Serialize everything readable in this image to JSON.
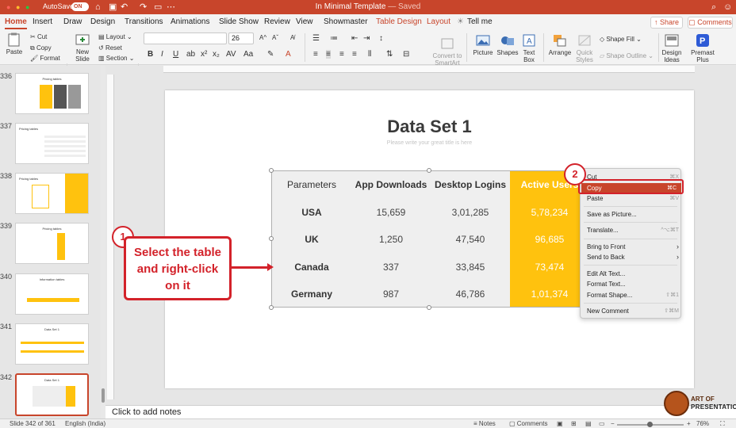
{
  "titlebar": {
    "autosave_label": "AutoSave",
    "autosave_state": "ON",
    "doc_name": "In Minimal Template",
    "doc_status": "— Saved",
    "accent_color": "#c8452b"
  },
  "tabs": [
    {
      "label": "Home",
      "active": true
    },
    {
      "label": "Insert"
    },
    {
      "label": "Draw"
    },
    {
      "label": "Design"
    },
    {
      "label": "Transitions"
    },
    {
      "label": "Animations"
    },
    {
      "label": "Slide Show"
    },
    {
      "label": "Review"
    },
    {
      "label": "View"
    },
    {
      "label": "Showmaster"
    },
    {
      "label": "Table Design",
      "contextual": true
    },
    {
      "label": "Layout",
      "contextual": true
    },
    {
      "label": "Tell me"
    }
  ],
  "share_label": "Share",
  "comments_label": "Comments",
  "ribbon": {
    "paste": "Paste",
    "cut": "Cut",
    "copy": "Copy",
    "format": "Format",
    "new_slide": "New Slide",
    "layout": "Layout",
    "reset": "Reset",
    "section": "Section",
    "font_size": "26",
    "convert_smartart": "Convert to SmartArt",
    "picture": "Picture",
    "shapes": "Shapes",
    "text_box": "Text Box",
    "arrange": "Arrange",
    "quick_styles": "Quick Styles",
    "shape_fill": "Shape Fill",
    "shape_outline": "Shape Outline",
    "design_ideas": "Design Ideas",
    "premast_plus": "Premast Plus"
  },
  "slides": [
    {
      "num": "336",
      "title": "Pricing tables"
    },
    {
      "num": "337",
      "title": "Pricing tables"
    },
    {
      "num": "338",
      "title": "Pricing tables"
    },
    {
      "num": "339",
      "title": "Pricing tables"
    },
    {
      "num": "340",
      "title": "Information tables"
    },
    {
      "num": "341",
      "title": "Data Set 1"
    },
    {
      "num": "342",
      "title": "Data Set 1",
      "selected": true
    }
  ],
  "slide": {
    "title": "Data Set 1",
    "subtitle": "Please write your great title is here"
  },
  "table": {
    "headers": [
      "Parameters",
      "App Downloads",
      "Desktop Logins",
      "Active Users"
    ],
    "rows": [
      [
        "USA",
        "15,659",
        "3,01,285",
        "5,78,234"
      ],
      [
        "UK",
        "1,250",
        "47,540",
        "96,685"
      ],
      [
        "Canada",
        "337",
        "33,845",
        "73,474"
      ],
      [
        "Germany",
        "987",
        "46,786",
        "1,01,374"
      ]
    ],
    "highlight_color": "#ffc20e"
  },
  "context_menu": [
    {
      "label": "Cut",
      "shortcut": "⌘X"
    },
    {
      "label": "Copy",
      "shortcut": "⌘C",
      "highlighted": true
    },
    {
      "label": "Paste",
      "shortcut": "⌘V"
    },
    {
      "label": "Save as Picture..."
    },
    {
      "label": "Translate...",
      "shortcut": "^⌥⌘T"
    },
    {
      "label": "Bring to Front",
      "submenu": true
    },
    {
      "label": "Send to Back",
      "submenu": true
    },
    {
      "label": "Edit Alt Text..."
    },
    {
      "label": "Format Text..."
    },
    {
      "label": "Format Shape...",
      "shortcut": "⇧⌘1"
    },
    {
      "label": "New Comment",
      "shortcut": "⇧⌘M"
    }
  ],
  "annotations": {
    "step1_num": "1",
    "step1_text_line1": "Select the table",
    "step1_text_line2": "and right-click",
    "step1_text_line3": "on it",
    "step2_num": "2",
    "color": "#d3222a"
  },
  "notes_placeholder": "Click to add notes",
  "status": {
    "slide_info": "Slide 342 of 361",
    "language": "English (India)",
    "notes": "Notes",
    "comments": "Comments",
    "zoom": "76%"
  },
  "logo": {
    "line1": "ART OF",
    "line2": "PRESENTATIONS"
  }
}
